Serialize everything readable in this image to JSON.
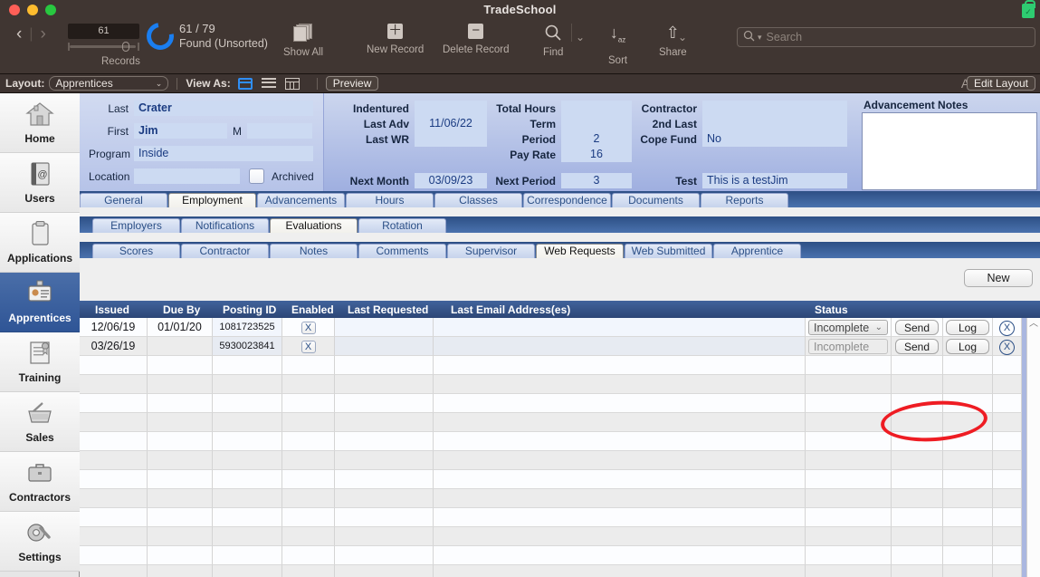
{
  "window": {
    "title": "TradeSchool",
    "lock_icon": "lock-icon"
  },
  "toolbar": {
    "record_number": "61",
    "found_count": "61 / 79",
    "found_status": "Found (Unsorted)",
    "records_label": "Records",
    "items": [
      {
        "label": "Show All",
        "icon": "stack-icon"
      },
      {
        "label": "New Record",
        "icon": "plus-square-icon"
      },
      {
        "label": "Delete Record",
        "icon": "minus-square-icon"
      },
      {
        "label": "Find",
        "icon": "magnifier-icon"
      },
      {
        "label": "Sort",
        "icon": "sort-az-icon"
      },
      {
        "label": "Share",
        "icon": "share-icon"
      }
    ],
    "search_placeholder": "Search",
    "search_value": ""
  },
  "layoutbar": {
    "layout_label": "Layout:",
    "layout_value": "Apprentices",
    "view_as_label": "View As:",
    "view_modes": [
      "form-view-icon",
      "list-view-icon",
      "table-view-icon"
    ],
    "preview_label": "Preview",
    "text_format_icon": "Aa",
    "edit_layout_label": "Edit Layout"
  },
  "sidebar": {
    "items": [
      {
        "label": "Home",
        "icon": "house-icon",
        "active": false
      },
      {
        "label": "Users",
        "icon": "address-book-icon",
        "active": false
      },
      {
        "label": "Applications",
        "icon": "clipboard-icon",
        "active": false
      },
      {
        "label": "Apprentices",
        "icon": "id-badge-icon",
        "active": true
      },
      {
        "label": "Training",
        "icon": "certificate-icon",
        "active": false
      },
      {
        "label": "Sales",
        "icon": "basket-icon",
        "active": false
      },
      {
        "label": "Contractors",
        "icon": "briefcase-icon",
        "active": false
      },
      {
        "label": "Settings",
        "icon": "wrench-gear-icon",
        "active": false
      }
    ]
  },
  "form": {
    "left": {
      "last_label": "Last",
      "last_value": "Crater",
      "first_label": "First",
      "first_value": "Jim",
      "middle_label": "M",
      "middle_value": "",
      "program_label": "Program",
      "program_value": "Inside",
      "location_label": "Location",
      "location_value": "",
      "archived_label": "Archived",
      "archived_checked": false
    },
    "col2": {
      "indentured_label": "Indentured",
      "indentured_value": "",
      "last_adv_label": "Last Adv",
      "last_adv_value": "11/06/22",
      "last_wr_label": "Last WR",
      "last_wr_value": "",
      "next_month_label": "Next Month",
      "next_month_value": "03/09/23"
    },
    "col3": {
      "total_hours_label": "Total Hours",
      "total_hours_value": "",
      "term_label": "Term",
      "term_value": "",
      "period_label": "Period",
      "period_value": "2",
      "pay_rate_label": "Pay Rate",
      "pay_rate_value": "16",
      "next_period_label": "Next Period",
      "next_period_value": "3"
    },
    "col4": {
      "contractor_label": "Contractor",
      "contractor_value": "",
      "second_last_label": "2nd Last",
      "second_last_value": "",
      "cope_fund_label": "Cope Fund",
      "cope_fund_value": "No",
      "test_label": "Test",
      "test_value": "This is a testJim"
    },
    "notes": {
      "label": "Advancement Notes",
      "value": ""
    }
  },
  "tabs": {
    "level1": [
      {
        "label": "General",
        "selected": false
      },
      {
        "label": "Employment",
        "selected": true
      },
      {
        "label": "Advancements",
        "selected": false
      },
      {
        "label": "Hours",
        "selected": false
      },
      {
        "label": "Classes",
        "selected": false
      },
      {
        "label": "Correspondence",
        "selected": false
      },
      {
        "label": "Documents",
        "selected": false
      },
      {
        "label": "Reports",
        "selected": false
      }
    ],
    "level2": [
      {
        "label": "Employers",
        "selected": false
      },
      {
        "label": "Notifications",
        "selected": false
      },
      {
        "label": "Evaluations",
        "selected": true
      },
      {
        "label": "Rotation",
        "selected": false
      }
    ],
    "level3": [
      {
        "label": "Scores",
        "selected": false
      },
      {
        "label": "Contractor",
        "selected": false
      },
      {
        "label": "Notes",
        "selected": false
      },
      {
        "label": "Comments",
        "selected": false
      },
      {
        "label": "Supervisor",
        "selected": false
      },
      {
        "label": "Web Requests",
        "selected": true
      },
      {
        "label": "Web Submitted",
        "selected": false
      },
      {
        "label": "Apprentice",
        "selected": false
      }
    ]
  },
  "content": {
    "new_button": "New",
    "table": {
      "columns": [
        "Issued",
        "Due By",
        "Posting ID",
        "Enabled",
        "Last Requested",
        "Last Email Address(es)",
        "Status"
      ],
      "rows": [
        {
          "issued": "12/06/19",
          "due_by": "01/01/20",
          "posting_id": "1081723525",
          "enabled": "X",
          "last_requested": "",
          "last_email": "",
          "status": "Incomplete",
          "status_is_dropdown": true,
          "send": "Send",
          "log": "Log",
          "delete": "X"
        },
        {
          "issued": "03/26/19",
          "due_by": "",
          "posting_id": "5930023841",
          "enabled": "X",
          "last_requested": "",
          "last_email": "",
          "status": "Incomplete",
          "status_is_dropdown": false,
          "send": "Send",
          "log": "Log",
          "delete": "X"
        }
      ],
      "empty_row_count": 12,
      "scroll_up_icon": "chevron-up-icon"
    },
    "annotation": {
      "shape": "red-ellipse-highlight",
      "color": "#ee1c23",
      "targets": "status-dropdown"
    }
  }
}
